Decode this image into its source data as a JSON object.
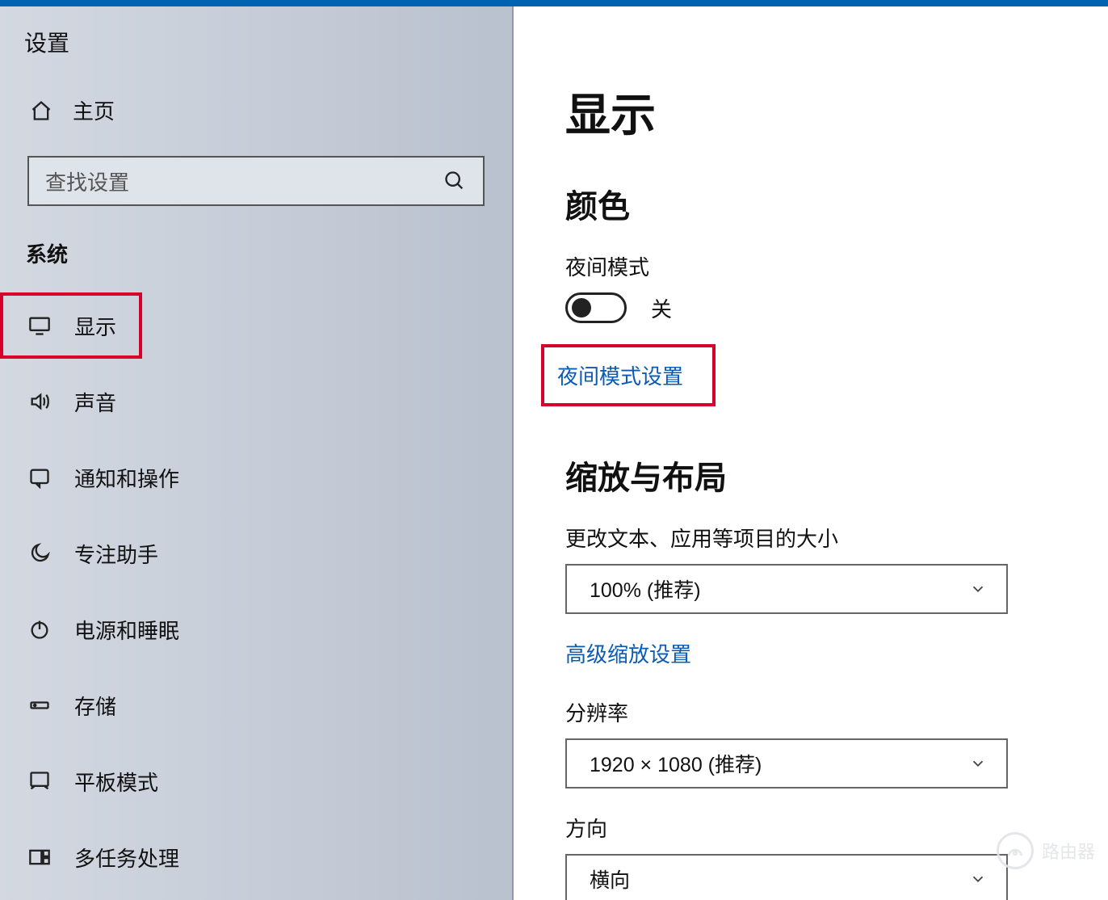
{
  "app": {
    "title": "设置"
  },
  "sidebar": {
    "home_label": "主页",
    "search_placeholder": "查找设置",
    "section_label": "系统",
    "items": [
      {
        "label": "显示",
        "icon": "monitor-icon",
        "highlighted": true
      },
      {
        "label": "声音",
        "icon": "sound-icon"
      },
      {
        "label": "通知和操作",
        "icon": "notification-icon"
      },
      {
        "label": "专注助手",
        "icon": "moon-icon"
      },
      {
        "label": "电源和睡眠",
        "icon": "power-icon"
      },
      {
        "label": "存储",
        "icon": "storage-icon"
      },
      {
        "label": "平板模式",
        "icon": "tablet-icon"
      },
      {
        "label": "多任务处理",
        "icon": "multitask-icon"
      }
    ]
  },
  "main": {
    "page_title": "显示",
    "section_color": {
      "heading": "颜色",
      "night_mode_label": "夜间模式",
      "toggle_state": "关",
      "settings_link": "夜间模式设置"
    },
    "section_scale": {
      "heading": "缩放与布局",
      "text_size_label": "更改文本、应用等项目的大小",
      "text_size_value": "100% (推荐)",
      "advanced_link": "高级缩放设置",
      "resolution_label": "分辨率",
      "resolution_value": "1920 × 1080 (推荐)",
      "orientation_label": "方向",
      "orientation_value": "横向"
    }
  },
  "watermark": {
    "label": "路由器"
  }
}
